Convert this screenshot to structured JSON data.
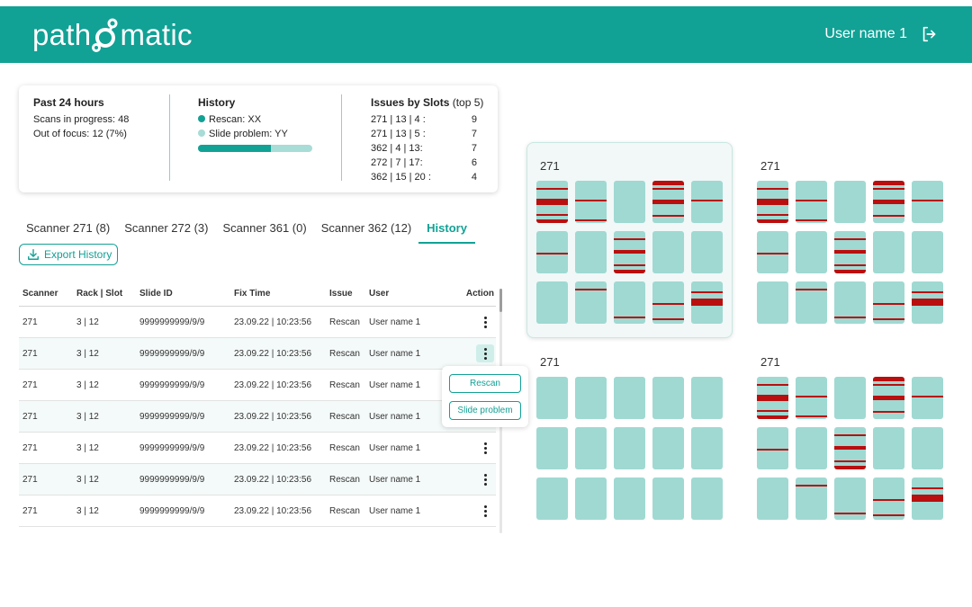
{
  "header": {
    "logo_left": "path",
    "logo_right": "matic",
    "user_name": "User name 1",
    "logout_icon": "logout-icon",
    "color": "#12a195"
  },
  "stats": {
    "past24": {
      "title": "Past 24 hours",
      "scans_label": "Scans in progress:",
      "scans_value": "48",
      "focus_label": "Out of focus:",
      "focus_value": "12 (7%)"
    },
    "history": {
      "title": "History",
      "rescan": "Rescan: XX",
      "slide_problem": "Slide problem: YY",
      "rescan_fraction": 0.64,
      "rescan_color": "#12a195",
      "slide_problem_color": "#a8dcd6"
    },
    "issues": {
      "title": "Issues by Slots",
      "subtitle": "(top 5)",
      "rows": [
        {
          "slot": "271 | 13 | 4 :",
          "count": "9"
        },
        {
          "slot": "271 | 13 | 5 :",
          "count": "7"
        },
        {
          "slot": "362 | 4 | 13:",
          "count": "7"
        },
        {
          "slot": "272 | 7 | 17:",
          "count": "6"
        },
        {
          "slot": "362 | 15 | 20 :",
          "count": "4"
        }
      ]
    }
  },
  "tabs": [
    {
      "label": "Scanner 271 (8)",
      "active": false
    },
    {
      "label": "Scanner 272 (3)",
      "active": false
    },
    {
      "label": "Scanner 361 (0)",
      "active": false
    },
    {
      "label": "Scanner 362 (12)",
      "active": false
    },
    {
      "label": "History",
      "active": true
    }
  ],
  "export_button": {
    "label": "Export History",
    "icon": "download-icon"
  },
  "table": {
    "headers": [
      "Scanner",
      "Rack | Slot",
      "Slide ID",
      "Fix Time",
      "Issue",
      "User",
      "Action"
    ],
    "rows": [
      [
        "271",
        "3 | 12",
        "9999999999/9/9",
        "23.09.22 | 10:23:56",
        "Rescan",
        "User name 1"
      ],
      [
        "271",
        "3 | 12",
        "9999999999/9/9",
        "23.09.22 | 10:23:56",
        "Rescan",
        "User name 1"
      ],
      [
        "271",
        "3 | 12",
        "9999999999/9/9",
        "23.09.22 | 10:23:56",
        "Rescan",
        "User name 1"
      ],
      [
        "271",
        "3 | 12",
        "9999999999/9/9",
        "23.09.22 | 10:23:56",
        "Rescan",
        "User name 1"
      ],
      [
        "271",
        "3 | 12",
        "9999999999/9/9",
        "23.09.22 | 10:23:56",
        "Rescan",
        "User name 1"
      ],
      [
        "271",
        "3 | 12",
        "9999999999/9/9",
        "23.09.22 | 10:23:56",
        "Rescan",
        "User name 1"
      ],
      [
        "271",
        "3 | 12",
        "9999999999/9/9",
        "23.09.22 | 10:23:56",
        "Rescan",
        "User name 1"
      ]
    ],
    "active_action_row": 1
  },
  "action_menu": {
    "rescan_label": "Rescan",
    "slide_problem_label": "Slide problem"
  },
  "racks": [
    {
      "label": "271",
      "selected": true,
      "slides": [
        {
          "lines": [
            0.18,
            0.46,
            0.78
          ],
          "bands": [
            [
              0.42,
              0.58
            ],
            [
              0.92,
              1.0
            ]
          ]
        },
        {
          "lines": [
            0.45,
            0.92
          ],
          "bands": []
        },
        {
          "lines": [],
          "bands": []
        },
        {
          "lines": [
            0.18,
            0.49,
            0.8
          ],
          "bands": [
            [
              0.0,
              0.1
            ],
            [
              0.45,
              0.55
            ]
          ]
        },
        {
          "lines": [
            0.45
          ],
          "bands": []
        },
        {
          "lines": [
            0.5
          ],
          "bands": []
        },
        {
          "lines": [],
          "bands": []
        },
        {
          "lines": [
            0.16,
            0.48,
            0.78
          ],
          "bands": [
            [
              0.44,
              0.54
            ],
            [
              0.92,
              1.0
            ]
          ]
        },
        {
          "lines": [],
          "bands": []
        },
        {
          "lines": [],
          "bands": []
        },
        {
          "lines": [],
          "bands": []
        },
        {
          "lines": [
            0.16
          ],
          "bands": []
        },
        {
          "lines": [
            0.82
          ],
          "bands": []
        },
        {
          "lines": [
            0.5,
            0.87
          ],
          "bands": []
        },
        {
          "lines": [
            0.24,
            0.4
          ],
          "bands": [
            [
              0.42,
              0.58
            ]
          ]
        }
      ]
    },
    {
      "label": "271",
      "selected": false,
      "slides": [
        {
          "lines": [
            0.18,
            0.46,
            0.78
          ],
          "bands": [
            [
              0.42,
              0.58
            ],
            [
              0.92,
              1.0
            ]
          ]
        },
        {
          "lines": [
            0.45,
            0.92
          ],
          "bands": []
        },
        {
          "lines": [],
          "bands": []
        },
        {
          "lines": [
            0.18,
            0.49,
            0.8
          ],
          "bands": [
            [
              0.0,
              0.1
            ],
            [
              0.45,
              0.55
            ]
          ]
        },
        {
          "lines": [
            0.45
          ],
          "bands": []
        },
        {
          "lines": [
            0.5
          ],
          "bands": []
        },
        {
          "lines": [],
          "bands": []
        },
        {
          "lines": [
            0.16,
            0.48,
            0.78
          ],
          "bands": [
            [
              0.44,
              0.54
            ],
            [
              0.92,
              1.0
            ]
          ]
        },
        {
          "lines": [],
          "bands": []
        },
        {
          "lines": [],
          "bands": []
        },
        {
          "lines": [],
          "bands": []
        },
        {
          "lines": [
            0.16
          ],
          "bands": []
        },
        {
          "lines": [
            0.82
          ],
          "bands": []
        },
        {
          "lines": [
            0.5,
            0.87
          ],
          "bands": []
        },
        {
          "lines": [
            0.24,
            0.4
          ],
          "bands": [
            [
              0.42,
              0.58
            ]
          ]
        }
      ]
    },
    {
      "label": "271",
      "selected": false,
      "slides": [
        {
          "lines": [],
          "bands": []
        },
        {
          "lines": [],
          "bands": []
        },
        {
          "lines": [],
          "bands": []
        },
        {
          "lines": [],
          "bands": []
        },
        {
          "lines": [],
          "bands": []
        },
        {
          "lines": [],
          "bands": []
        },
        {
          "lines": [],
          "bands": []
        },
        {
          "lines": [],
          "bands": []
        },
        {
          "lines": [],
          "bands": []
        },
        {
          "lines": [],
          "bands": []
        },
        {
          "lines": [],
          "bands": []
        },
        {
          "lines": [],
          "bands": []
        },
        {
          "lines": [],
          "bands": []
        },
        {
          "lines": [],
          "bands": []
        },
        {
          "lines": [],
          "bands": []
        }
      ]
    },
    {
      "label": "271",
      "selected": false,
      "slides": [
        {
          "lines": [
            0.18,
            0.46,
            0.78
          ],
          "bands": [
            [
              0.42,
              0.58
            ],
            [
              0.92,
              1.0
            ]
          ]
        },
        {
          "lines": [
            0.45,
            0.92
          ],
          "bands": []
        },
        {
          "lines": [],
          "bands": []
        },
        {
          "lines": [
            0.18,
            0.49,
            0.8
          ],
          "bands": [
            [
              0.0,
              0.1
            ],
            [
              0.45,
              0.55
            ]
          ]
        },
        {
          "lines": [
            0.45
          ],
          "bands": []
        },
        {
          "lines": [
            0.5
          ],
          "bands": []
        },
        {
          "lines": [],
          "bands": []
        },
        {
          "lines": [
            0.16,
            0.48,
            0.78
          ],
          "bands": [
            [
              0.44,
              0.54
            ],
            [
              0.92,
              1.0
            ]
          ]
        },
        {
          "lines": [],
          "bands": []
        },
        {
          "lines": [],
          "bands": []
        },
        {
          "lines": [],
          "bands": []
        },
        {
          "lines": [
            0.16
          ],
          "bands": []
        },
        {
          "lines": [
            0.82
          ],
          "bands": []
        },
        {
          "lines": [
            0.5,
            0.87
          ],
          "bands": []
        },
        {
          "lines": [
            0.24,
            0.4
          ],
          "bands": [
            [
              0.42,
              0.58
            ]
          ]
        }
      ]
    }
  ],
  "colors": {
    "accent": "#12a195",
    "slide": "#9fd9d2",
    "issue": "#b90f0f"
  }
}
